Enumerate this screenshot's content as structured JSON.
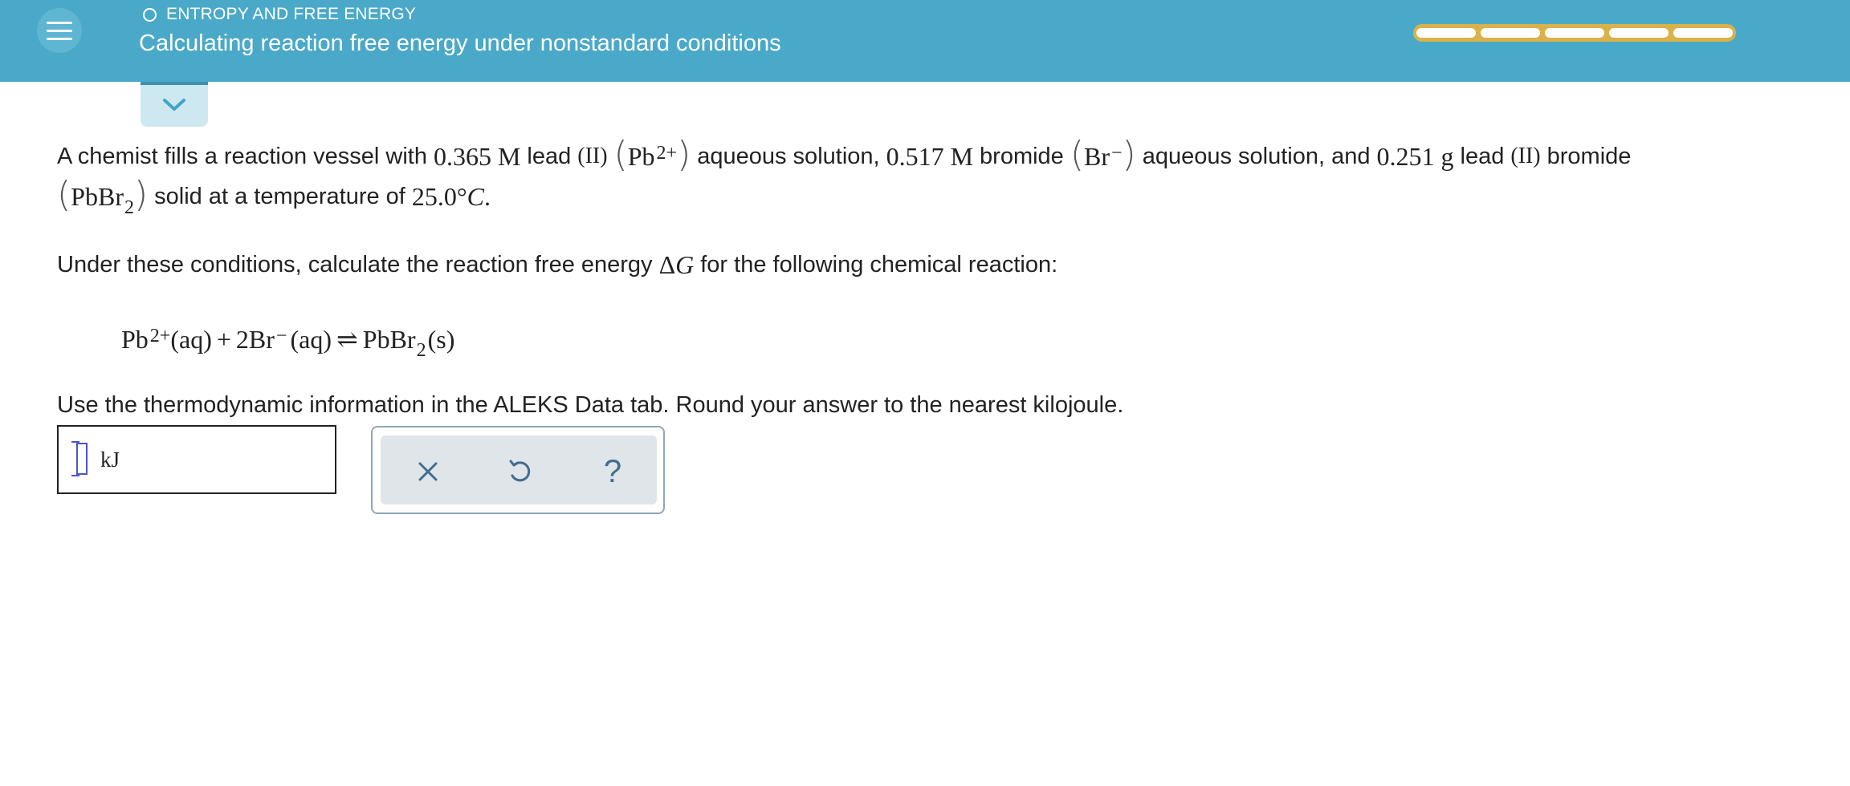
{
  "header": {
    "topic": "ENTROPY AND FREE ENERGY",
    "title": "Calculating reaction free energy under nonstandard conditions",
    "progress_segments": 5
  },
  "problem": {
    "line1": {
      "p1": "A chemist fills a reaction vessel with",
      "conc1": "0.365",
      "m1": "M",
      "p2": "lead",
      "ox1": "(II)",
      "pb": "Pb",
      "pb_charge": "2+",
      "p3": "aqueous solution,",
      "conc2": "0.517",
      "m2": "M",
      "p4": "bromide",
      "br": "Br",
      "br_charge": "−",
      "p5": "aqueous solution, and",
      "mass": "0.251",
      "g": "g",
      "p6": "lead",
      "ox2": "(II)",
      "p7": "bromide"
    },
    "line2": {
      "pbbr": "PbBr",
      "pbbr_sub": "2",
      "p1": "solid at a temperature of",
      "temp": "25.0°",
      "temp_unit": "C",
      "end": "."
    },
    "line3": {
      "p1": "Under these conditions, calculate the reaction free energy",
      "delta": "Δ",
      "g": "G",
      "p2": "for the following chemical reaction:"
    },
    "reaction": {
      "pb": "Pb",
      "pb_charge": "2+",
      "aq1": "(aq)",
      "plus": "+",
      "coef": "2",
      "br": "Br",
      "br_charge": "−",
      "aq2": "(aq)",
      "arrow": "⇌",
      "prod": "PbBr",
      "prod_sub": "2",
      "s": "(s)"
    },
    "line4": "Use the thermodynamic information in the ALEKS Data tab. Round your answer to the nearest kilojoule."
  },
  "answer": {
    "value": "",
    "unit": "kJ"
  },
  "tools": {
    "clear": "×",
    "undo": "undo-icon",
    "help": "?"
  },
  "colors": {
    "header_bg": "#4aa9c8",
    "progress": "#d9b24a",
    "tab_bg": "#cde8f0",
    "tool_bg": "#dfe5e8",
    "icon": "#3f6d8e"
  }
}
